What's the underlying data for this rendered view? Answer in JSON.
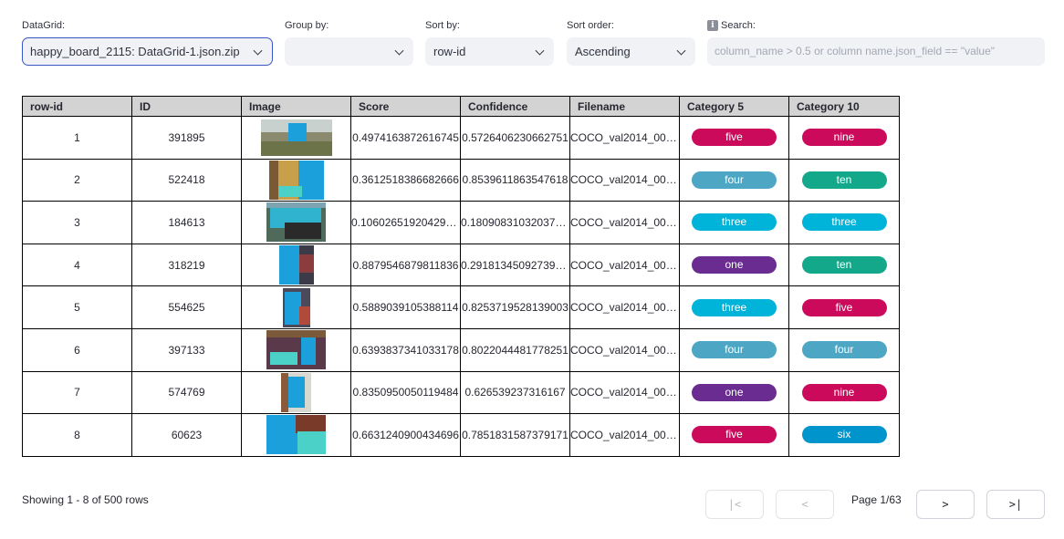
{
  "controls": {
    "datagrid": {
      "label": "DataGrid:",
      "value": "happy_board_2115: DataGrid-1.json.zip"
    },
    "group_by": {
      "label": "Group by:",
      "value": ""
    },
    "sort_by": {
      "label": "Sort by:",
      "value": "row-id"
    },
    "sort_order": {
      "label": "Sort order:",
      "value": "Ascending"
    },
    "search": {
      "label": "Search:",
      "placeholder": "column_name > 0.5 or column name.json_field == \"value\"",
      "icon": "info-icon"
    }
  },
  "table": {
    "columns": [
      "row-id",
      "ID",
      "Image",
      "Score",
      "Confidence",
      "Filename",
      "Category 5",
      "Category 10"
    ],
    "rows": [
      {
        "row_id": "1",
        "id": "391895",
        "score": "0.4974163872616745",
        "confidence": "0.5726406230662751",
        "filename": "COCO_val2014_000...",
        "cat5": "five",
        "cat10": "nine"
      },
      {
        "row_id": "2",
        "id": "522418",
        "score": "0.3612518386682666",
        "confidence": "0.8539611863547618",
        "filename": "COCO_val2014_000...",
        "cat5": "four",
        "cat10": "ten"
      },
      {
        "row_id": "3",
        "id": "184613",
        "score": "0.106026519204299...",
        "confidence": "0.180908310320372...",
        "filename": "COCO_val2014_000...",
        "cat5": "three",
        "cat10": "three"
      },
      {
        "row_id": "4",
        "id": "318219",
        "score": "0.8879546879811836",
        "confidence": "0.291813450927397...",
        "filename": "COCO_val2014_000...",
        "cat5": "one",
        "cat10": "ten"
      },
      {
        "row_id": "5",
        "id": "554625",
        "score": "0.5889039105388114",
        "confidence": "0.8253719528139003",
        "filename": "COCO_val2014_000...",
        "cat5": "three",
        "cat10": "five"
      },
      {
        "row_id": "6",
        "id": "397133",
        "score": "0.6393837341033178",
        "confidence": "0.8022044481778251",
        "filename": "COCO_val2014_000...",
        "cat5": "four",
        "cat10": "four"
      },
      {
        "row_id": "7",
        "id": "574769",
        "score": "0.8350950050119484",
        "confidence": "0.626539237316167",
        "filename": "COCO_val2014_000...",
        "cat5": "one",
        "cat10": "nine"
      },
      {
        "row_id": "8",
        "id": "60623",
        "score": "0.6631240900434696",
        "confidence": "0.7851831587379171",
        "filename": "COCO_val2014_000...",
        "cat5": "five",
        "cat10": "six"
      }
    ]
  },
  "category_colors": {
    "one": "#6a2c91",
    "three": "#00b3d9",
    "four": "#4da6c4",
    "five": "#cc0a5c",
    "six": "#0094cc",
    "nine": "#cc0a5c",
    "ten": "#13a88a"
  },
  "footer": {
    "showing": "Showing 1 - 8 of 500 rows",
    "page": "Page 1/63",
    "first": "|<",
    "prev": "<",
    "next": ">",
    "last": ">|"
  }
}
